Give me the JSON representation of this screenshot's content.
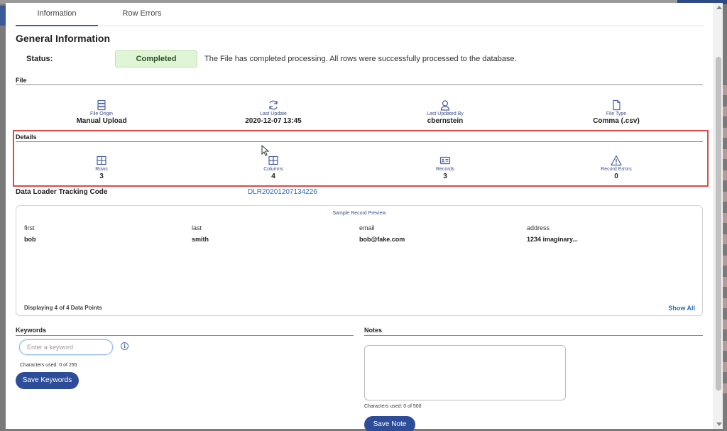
{
  "background": {
    "accent": "#2d4a86"
  },
  "tabs": [
    {
      "label": "Information",
      "active": true
    },
    {
      "label": "Row Errors",
      "active": false
    }
  ],
  "general": {
    "heading": "General Information",
    "status_label": "Status:",
    "status_value": "Completed",
    "status_color": "#dff5d5",
    "status_message": "The File has completed processing. All rows were successfully processed to the database."
  },
  "file": {
    "title": "File",
    "stats": [
      {
        "icon": "server-icon",
        "label": "File Origin",
        "value": "Manual Upload"
      },
      {
        "icon": "refresh-icon",
        "label": "Last Update",
        "value": "2020-12-07 13:45"
      },
      {
        "icon": "user-icon",
        "label": "Last Updated By",
        "value": "cbernstein"
      },
      {
        "icon": "document-icon",
        "label": "File Type",
        "value": "Comma (.csv)"
      }
    ]
  },
  "details": {
    "title": "Details",
    "highlight_color": "#e04848",
    "stats": [
      {
        "icon": "table-icon",
        "label": "Rows",
        "value": "3"
      },
      {
        "icon": "columns-icon",
        "label": "Columns",
        "value": "4"
      },
      {
        "icon": "id-card-icon",
        "label": "Records",
        "value": "3"
      },
      {
        "icon": "warning-icon",
        "label": "Record Errors",
        "value": "0"
      }
    ]
  },
  "tracking": {
    "label": "Data Loader Tracking Code",
    "code": "DLR20201207134226"
  },
  "preview": {
    "title": "Sample Record Preview",
    "columns": [
      {
        "header": "first",
        "value": "bob"
      },
      {
        "header": "last",
        "value": "smith"
      },
      {
        "header": "email",
        "value": "bob@fake.com"
      },
      {
        "header": "address",
        "value": "1234 imaginary..."
      }
    ],
    "footer": "Displaying 4 of 4 Data Points",
    "show_all": "Show All"
  },
  "keywords": {
    "title": "Keywords",
    "placeholder": "Enter a keyword",
    "chars": "Characters used: 0 of 255",
    "save_label": "Save Keywords"
  },
  "notes": {
    "title": "Notes",
    "chars": "Characters used: 0 of 500",
    "save_label": "Save Note"
  }
}
